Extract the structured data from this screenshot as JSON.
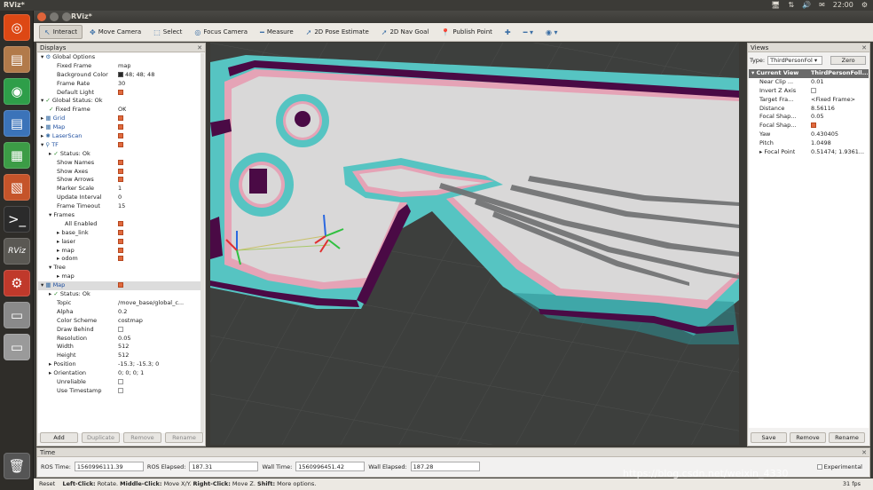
{
  "top_panel": {
    "title": "RViz*",
    "tray": [
      "🖥",
      "⇅",
      "🔊",
      "✉",
      "22:00",
      "⚙"
    ]
  },
  "launcher": {
    "items": [
      {
        "name": "ubuntu-dash-icon",
        "glyph": "◎",
        "color": "#dd4814"
      },
      {
        "name": "files-icon",
        "glyph": "▤",
        "color": "#b27a4a"
      },
      {
        "name": "chrome-icon",
        "glyph": "◉",
        "color": "#2e9e49"
      },
      {
        "name": "writer-icon",
        "glyph": "▤",
        "color": "#3b73b9"
      },
      {
        "name": "calc-icon",
        "glyph": "▦",
        "color": "#3c9c46"
      },
      {
        "name": "impress-icon",
        "glyph": "▧",
        "color": "#c5542a"
      },
      {
        "name": "terminal-icon",
        "glyph": ">_",
        "color": "#2b2b2b"
      },
      {
        "name": "rviz-icon",
        "glyph": "RViz",
        "color": "#5a5853"
      },
      {
        "name": "settings-icon",
        "glyph": "⚙",
        "color": "#c0392b"
      },
      {
        "name": "drive-icon",
        "glyph": "▭",
        "color": "#8a8a8a"
      },
      {
        "name": "drive-2-icon",
        "glyph": "▭",
        "color": "#9a9a9a"
      },
      {
        "name": "trash-icon",
        "glyph": "🗑",
        "color": "#555555"
      }
    ]
  },
  "window": {
    "title": "RViz*"
  },
  "toolbar": [
    {
      "label": "Interact",
      "icon": "↖",
      "name": "interact-tool",
      "active": true
    },
    {
      "label": "Move Camera",
      "icon": "✥",
      "name": "move-camera-tool"
    },
    {
      "label": "Select",
      "icon": "⬚",
      "name": "select-tool"
    },
    {
      "label": "Focus Camera",
      "icon": "◎",
      "name": "focus-camera-tool"
    },
    {
      "label": "Measure",
      "icon": "━",
      "name": "measure-tool"
    },
    {
      "label": "2D Pose Estimate",
      "icon": "➚",
      "name": "pose-estimate-tool"
    },
    {
      "label": "2D Nav Goal",
      "icon": "➚",
      "name": "nav-goal-tool"
    },
    {
      "label": "Publish Point",
      "icon": "📍",
      "name": "publish-point-tool"
    },
    {
      "label": "",
      "icon": "✚",
      "name": "add-tool"
    },
    {
      "label": "",
      "icon": "━ ▾",
      "name": "remove-tool"
    },
    {
      "label": "",
      "icon": "◉ ▾",
      "name": "camera-type-tool"
    }
  ],
  "displays": {
    "title": "Displays",
    "rows": [
      {
        "i": 0,
        "a": "▾",
        "ic": "⚙",
        "k": "Global Options",
        "v": ""
      },
      {
        "i": 2,
        "k": "Fixed Frame",
        "v": "map"
      },
      {
        "i": 2,
        "k": "Background Color",
        "v": "48; 48; 48",
        "sw": true
      },
      {
        "i": 2,
        "k": "Frame Rate",
        "v": "30"
      },
      {
        "i": 2,
        "k": "Default Light",
        "chk": true
      },
      {
        "i": 0,
        "a": "▾",
        "ic": "✓",
        "k": "Global Status: Ok",
        "v": ""
      },
      {
        "i": 1,
        "ic": "✓",
        "k": "Fixed Frame",
        "v": "OK"
      },
      {
        "i": 0,
        "a": "▸",
        "ic": "▦",
        "k": "Grid",
        "chk": true,
        "blue": true
      },
      {
        "i": 0,
        "a": "▸",
        "ic": "▦",
        "k": "Map",
        "chk": true,
        "blue": true
      },
      {
        "i": 0,
        "a": "▸",
        "ic": "✺",
        "k": "LaserScan",
        "chk": true,
        "blue": true
      },
      {
        "i": 0,
        "a": "▾",
        "ic": "⚲",
        "k": "TF",
        "chk": true,
        "blue": true
      },
      {
        "i": 1,
        "a": "▸",
        "ic": "✓",
        "k": "Status: Ok",
        "v": ""
      },
      {
        "i": 2,
        "k": "Show Names",
        "chk": true
      },
      {
        "i": 2,
        "k": "Show Axes",
        "chk": true
      },
      {
        "i": 2,
        "k": "Show Arrows",
        "chk": true
      },
      {
        "i": 2,
        "k": "Marker Scale",
        "v": "1"
      },
      {
        "i": 2,
        "k": "Update Interval",
        "v": "0"
      },
      {
        "i": 2,
        "k": "Frame Timeout",
        "v": "15"
      },
      {
        "i": 1,
        "a": "▾",
        "k": "Frames",
        "v": ""
      },
      {
        "i": 3,
        "k": "All Enabled",
        "chk": true
      },
      {
        "i": 2,
        "a": "▸",
        "k": "base_link",
        "chk": true
      },
      {
        "i": 2,
        "a": "▸",
        "k": "laser",
        "chk": true
      },
      {
        "i": 2,
        "a": "▸",
        "k": "map",
        "chk": true
      },
      {
        "i": 2,
        "a": "▸",
        "k": "odom",
        "chk": true
      },
      {
        "i": 1,
        "a": "▾",
        "k": "Tree",
        "v": ""
      },
      {
        "i": 2,
        "a": "▸",
        "k": "map",
        "v": ""
      },
      {
        "i": 0,
        "a": "▾",
        "ic": "▦",
        "k": "Map",
        "chk": true,
        "blue": true,
        "sel": true
      },
      {
        "i": 1,
        "a": "▸",
        "ic": "✓",
        "k": "Status: Ok",
        "v": ""
      },
      {
        "i": 2,
        "k": "Topic",
        "v": "/move_base/global_c..."
      },
      {
        "i": 2,
        "k": "Alpha",
        "v": "0.2"
      },
      {
        "i": 2,
        "k": "Color Scheme",
        "v": "costmap"
      },
      {
        "i": 2,
        "k": "Draw Behind",
        "chk": false
      },
      {
        "i": 2,
        "k": "Resolution",
        "v": "0.05"
      },
      {
        "i": 2,
        "k": "Width",
        "v": "512"
      },
      {
        "i": 2,
        "k": "Height",
        "v": "512"
      },
      {
        "i": 1,
        "a": "▸",
        "k": "Position",
        "v": "-15.3; -15.3; 0"
      },
      {
        "i": 1,
        "a": "▸",
        "k": "Orientation",
        "v": "0; 0; 0; 1"
      },
      {
        "i": 2,
        "k": "Unreliable",
        "chk": false
      },
      {
        "i": 2,
        "k": "Use Timestamp",
        "chk": false
      }
    ],
    "buttons": [
      {
        "label": "Add",
        "name": "add-display-button",
        "on": true
      },
      {
        "label": "Duplicate",
        "name": "duplicate-display-button"
      },
      {
        "label": "Remove",
        "name": "remove-display-button"
      },
      {
        "label": "Rename",
        "name": "rename-display-button"
      }
    ]
  },
  "views": {
    "title": "Views",
    "type_label": "Type:",
    "type_value": "ThirdPersonFol ▾",
    "zero_label": "Zero",
    "rows": [
      {
        "i": 0,
        "a": "▾",
        "k": "Current View",
        "v": "ThirdPersonFoll...",
        "cur": true
      },
      {
        "i": 1,
        "k": "Near Clip ...",
        "v": "0.01"
      },
      {
        "i": 1,
        "k": "Invert Z Axis",
        "chk": false
      },
      {
        "i": 1,
        "k": "Target Fra...",
        "v": "<Fixed Frame>"
      },
      {
        "i": 1,
        "k": "Distance",
        "v": "8.56116"
      },
      {
        "i": 1,
        "k": "Focal Shap...",
        "v": "0.05"
      },
      {
        "i": 1,
        "k": "Focal Shap...",
        "chk": true
      },
      {
        "i": 1,
        "k": "Yaw",
        "v": "0.430405"
      },
      {
        "i": 1,
        "k": "Pitch",
        "v": "1.0498"
      },
      {
        "i": 1,
        "a": "▸",
        "k": "Focal Point",
        "v": "0.51474; 1.9361..."
      }
    ],
    "buttons": [
      {
        "label": "Save",
        "name": "save-view-button"
      },
      {
        "label": "Remove",
        "name": "remove-view-button"
      },
      {
        "label": "Rename",
        "name": "rename-view-button"
      }
    ]
  },
  "time": {
    "title": "Time",
    "ros_time_label": "ROS Time:",
    "ros_time": "1560996111.39",
    "ros_elapsed_label": "ROS Elapsed:",
    "ros_elapsed": "187.31",
    "wall_time_label": "Wall Time:",
    "wall_time": "1560996451.42",
    "wall_elapsed_label": "Wall Elapsed:",
    "wall_elapsed": "187.28",
    "experimental_label": "Experimental"
  },
  "status": {
    "reset": "Reset",
    "hint_bold1": "Left-Click:",
    "hint1": "Rotate.",
    "hint_bold2": "Middle-Click:",
    "hint2": "Move X/Y.",
    "hint_bold3": "Right-Click:",
    "hint3": "Move Z.",
    "hint_bold4": "Shift:",
    "hint4": "More options.",
    "fps": "31 fps"
  },
  "watermark": "https://blog.csdn.net/weixin_4330",
  "colors": {
    "viewport_bg": "#3d3f3d",
    "free_space": "#d9d8d8",
    "inflation": "#56c4c2",
    "inflation_dark": "#2d8f93",
    "lethal": "#4a0a45",
    "border_pink": "#e5a3b6",
    "accent_orange": "#e06a3e"
  }
}
